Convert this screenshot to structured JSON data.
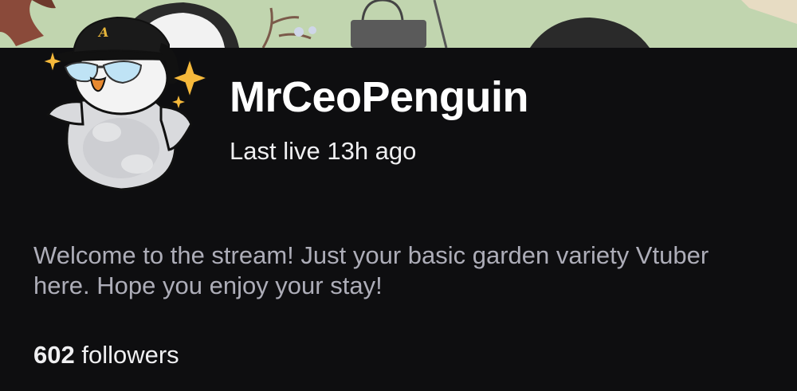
{
  "profile": {
    "channel_name": "MrCeoPenguin",
    "last_live": "Last live 13h ago",
    "bio": "Welcome to the stream! Just your basic garden variety Vtuber here. Hope you enjoy your stay!",
    "followers": {
      "count": "602",
      "label": "followers"
    }
  },
  "avatar": {
    "icon": "penguin-avatar-icon",
    "hat_letter": "A"
  },
  "colors": {
    "background": "#0e0e10",
    "name_text": "#ffffff",
    "bio_text": "#adadb8",
    "banner_green": "#b9cfa9"
  }
}
